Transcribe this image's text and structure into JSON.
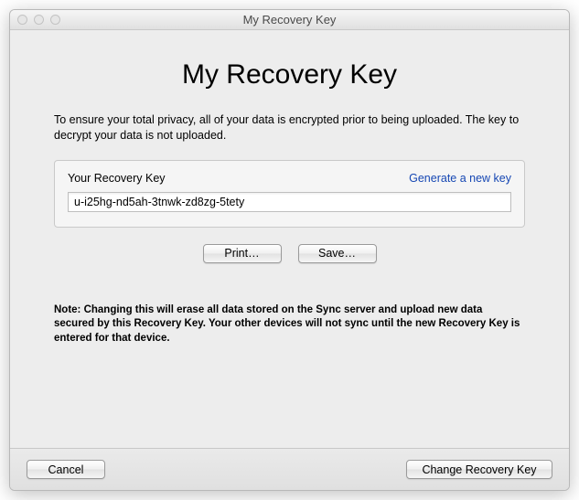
{
  "titlebar": {
    "title": "My Recovery Key"
  },
  "heading": "My Recovery Key",
  "intro": "To ensure your total privacy, all of your data is encrypted prior to being uploaded. The key to decrypt your data is not uploaded.",
  "panel": {
    "label": "Your Recovery Key",
    "link": "Generate a new key",
    "key_value": "u-i25hg-nd5ah-3tnwk-zd8zg-5tety"
  },
  "buttons": {
    "print": "Print…",
    "save": "Save…"
  },
  "note": "Note: Changing this will erase all data stored on the Sync server and upload new data secured by this Recovery Key. Your other devices will not sync until the new Recovery Key is entered for that device.",
  "footer": {
    "cancel": "Cancel",
    "change": "Change Recovery Key"
  }
}
